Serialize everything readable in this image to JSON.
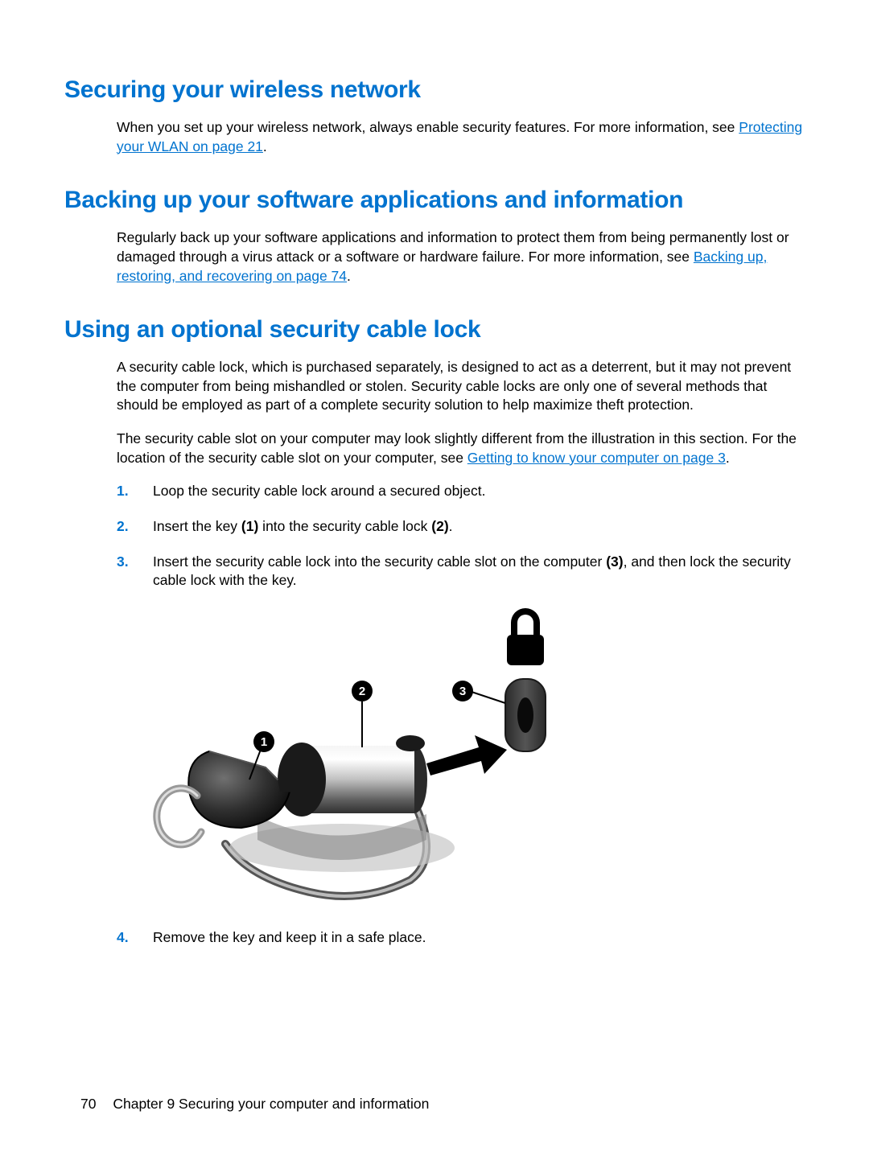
{
  "section1": {
    "heading": "Securing your wireless network",
    "para_before_link": "When you set up your wireless network, always enable security features. For more information, see ",
    "link": "Protecting your WLAN on page 21",
    "para_after_link": "."
  },
  "section2": {
    "heading": "Backing up your software applications and information",
    "para_before_link": "Regularly back up your software applications and information to protect them from being permanently lost or damaged through a virus attack or a software or hardware failure. For more information, see ",
    "link": "Backing up, restoring, and recovering on page 74",
    "para_after_link": "."
  },
  "section3": {
    "heading": "Using an optional security cable lock",
    "para1": "A security cable lock, which is purchased separately, is designed to act as a deterrent, but it may not prevent the computer from being mishandled or stolen. Security cable locks are only one of several methods that should be employed as part of a complete security solution to help maximize theft protection.",
    "para2_before_link": "The security cable slot on your computer may look slightly different from the illustration in this section. For the location of the security cable slot on your computer, see ",
    "para2_link": "Getting to know your computer on page 3",
    "para2_after_link": ".",
    "steps": {
      "n1": "1.",
      "s1": "Loop the security cable lock around a secured object.",
      "n2": "2.",
      "s2a": "Insert the key ",
      "s2b": "(1)",
      "s2c": " into the security cable lock ",
      "s2d": "(2)",
      "s2e": ".",
      "n3": "3.",
      "s3a": "Insert the security cable lock into the security cable slot on the computer ",
      "s3b": "(3)",
      "s3c": ", and then lock the security cable lock with the key.",
      "n4": "4.",
      "s4": "Remove the key and keep it in a safe place."
    }
  },
  "figure": {
    "callout1": "1",
    "callout2": "2",
    "callout3": "3"
  },
  "footer": {
    "page": "70",
    "chapter": "Chapter 9   Securing your computer and information"
  }
}
